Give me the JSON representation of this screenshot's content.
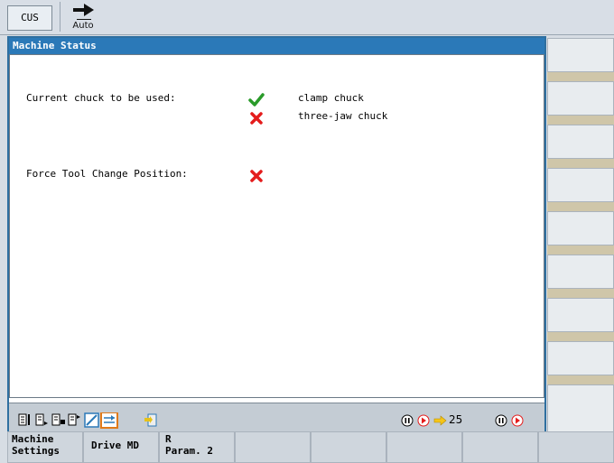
{
  "topbar": {
    "mode_label": "CUS",
    "op_mode_label": "Auto"
  },
  "window": {
    "title": "Machine Status",
    "rows": [
      {
        "label": "Current chuck to be used:",
        "items": [
          {
            "status": "check",
            "text": "clamp chuck"
          },
          {
            "status": "cross",
            "text": "three-jaw chuck"
          }
        ]
      },
      {
        "label": "Force Tool Change Position:",
        "items": [
          {
            "status": "cross",
            "text": ""
          }
        ]
      }
    ]
  },
  "statusbar": {
    "feed_override": "25"
  },
  "bottom_softkeys": [
    {
      "line1": "Machine",
      "line2": "Settings"
    },
    {
      "line1": "Drive MD",
      "line2": ""
    },
    {
      "line1": "R",
      "line2": "Param. 2"
    }
  ],
  "colors": {
    "title_bg": "#2b79b8",
    "check": "#2a9b2a",
    "cross": "#e41c1c",
    "highlight": "#e07a1a"
  }
}
